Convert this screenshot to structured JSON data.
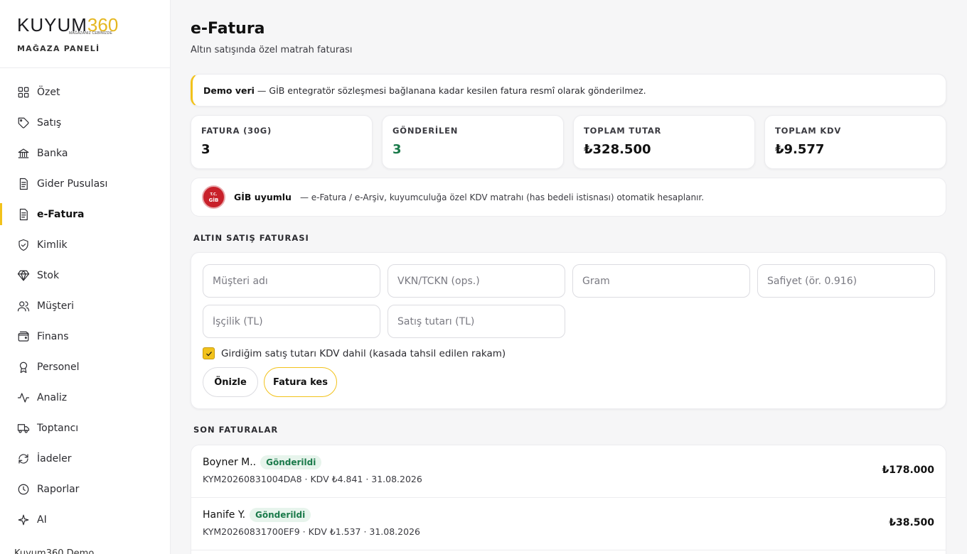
{
  "brand": {
    "logo_text": "KUYUM",
    "logo_num": "360",
    "logo_tagline": "MAĞAZANIZ CEBİNİZDE",
    "subtitle": "MAĞAZA PANELİ"
  },
  "sidebar": {
    "items": [
      {
        "label": "Özet",
        "icon": "grid-icon",
        "active": false
      },
      {
        "label": "Satış",
        "icon": "tag-icon",
        "active": false
      },
      {
        "label": "Banka",
        "icon": "bank-icon",
        "active": false
      },
      {
        "label": "Gider Pusulası",
        "icon": "receipt-icon",
        "active": false
      },
      {
        "label": "e-Fatura",
        "icon": "document-icon",
        "active": true
      },
      {
        "label": "Kimlik",
        "icon": "shield-check-icon",
        "active": false
      },
      {
        "label": "Stok",
        "icon": "diamond-icon",
        "active": false
      },
      {
        "label": "Müşteri",
        "icon": "users-icon",
        "active": false
      },
      {
        "label": "Finans",
        "icon": "wallet-icon",
        "active": false
      },
      {
        "label": "Personel",
        "icon": "award-icon",
        "active": false
      },
      {
        "label": "Analiz",
        "icon": "activity-icon",
        "active": false
      },
      {
        "label": "Toptancı",
        "icon": "truck-icon",
        "active": false
      },
      {
        "label": "İadeler",
        "icon": "refresh-icon",
        "active": false
      },
      {
        "label": "Raporlar",
        "icon": "clock-icon",
        "active": false
      },
      {
        "label": "AI",
        "icon": "sparkle-icon",
        "active": false
      }
    ],
    "footer": "Kuyum360 Demo"
  },
  "header": {
    "title": "e-Fatura",
    "subtitle": "Altın satışında özel matrah faturası"
  },
  "demo_notice": {
    "bold": "Demo veri",
    "text": "— GİB entegratör sözleşmesi bağlanana kadar kesilen fatura resmî olarak gönderilmez."
  },
  "stats": [
    {
      "label": "FATURA (30G)",
      "value": "3"
    },
    {
      "label": "GÖNDERİLEN",
      "value": "3"
    },
    {
      "label": "TOPLAM TUTAR",
      "value": "₺328.500"
    },
    {
      "label": "TOPLAM KDV",
      "value": "₺9.577"
    }
  ],
  "gib": {
    "badge_top": "T.C.",
    "badge_main": "GİB",
    "title": "GİB uyumlu",
    "text": "— e-Fatura / e-Arşiv, kuyumculuğa özel KDV matrahı (has bedeli istisnası) otomatik hesaplanır."
  },
  "form": {
    "section_title": "ALTIN SATIŞ FATURASI",
    "fields": {
      "customer": {
        "placeholder": "Müşteri adı",
        "value": ""
      },
      "vkn": {
        "placeholder": "VKN/TCKN (ops.)",
        "value": ""
      },
      "gram": {
        "placeholder": "Gram",
        "value": ""
      },
      "purity": {
        "placeholder": "Safiyet (ör. 0.916)",
        "value": ""
      },
      "labor": {
        "placeholder": "İşçilik (TL)",
        "value": ""
      },
      "amount": {
        "placeholder": "Satış tutarı (TL)",
        "value": ""
      }
    },
    "vat_included_label": "Girdiğim satış tutarı KDV dahil (kasada tahsil edilen rakam)",
    "vat_included_checked": true,
    "preview_label": "Önizle",
    "issue_label": "Fatura kes"
  },
  "recent": {
    "section_title": "SON FATURALAR",
    "rows": [
      {
        "name": "Boyner M..",
        "status": "Gönderildi",
        "meta": "KYM20260831004DA8 · KDV ₺4.841 · 31.08.2026",
        "amount": "₺178.000"
      },
      {
        "name": "Hanife Y.",
        "status": "Gönderildi",
        "meta": "KYM20260831700EF9 · KDV ₺1.537 · 31.08.2026",
        "amount": "₺38.500"
      }
    ]
  },
  "colors": {
    "accent": "#f2c21b",
    "success": "#1a7a4a",
    "gib_red": "#c8202a"
  }
}
